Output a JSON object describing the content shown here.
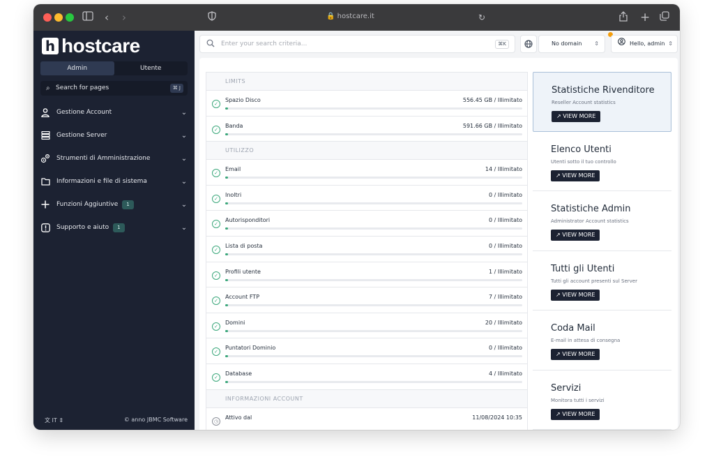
{
  "browser": {
    "address": "🔒 hostcare.it"
  },
  "sidebar": {
    "logo_letter": "h",
    "logo_text": "hostcare",
    "tabs": [
      "Admin",
      "Utente"
    ],
    "search_label": "Search for pages",
    "search_shortcut": "⌘ J",
    "items": [
      {
        "label": "Gestione Account",
        "icon": "user-icon"
      },
      {
        "label": "Gestione Server",
        "icon": "server-icon"
      },
      {
        "label": "Strumenti di Amministrazione",
        "icon": "gears-icon"
      },
      {
        "label": "Informazioni e file di sistema",
        "icon": "folder-icon"
      },
      {
        "label": "Funzioni Aggiuntive",
        "icon": "plus-icon",
        "badge": "1"
      },
      {
        "label": "Supporto e aiuto",
        "icon": "alert-icon",
        "badge": "1"
      }
    ],
    "language": "IT",
    "copyright": "© anno JBMC Software"
  },
  "topbar": {
    "search_placeholder": "Enter your search criteria...",
    "search_shortcut": "⌘K",
    "domain": "No domain",
    "user": "Hello, admin"
  },
  "stats": {
    "limits_header": "LIMITS",
    "limits": [
      {
        "label": "Spazio Disco",
        "value": "556.45 GB / Illimitato",
        "fill": 0.01
      },
      {
        "label": "Banda",
        "value": "591.66 GB / Illimitato",
        "fill": 0.01
      }
    ],
    "usage_header": "UTILIZZO",
    "usage": [
      {
        "label": "Email",
        "value": "14 / Illimitato",
        "fill": 0.01
      },
      {
        "label": "Inoltri",
        "value": "0 / Illimitato",
        "fill": 0.01
      },
      {
        "label": "Autorisponditori",
        "value": "0 / Illimitato",
        "fill": 0.01
      },
      {
        "label": "Lista di posta",
        "value": "0 / Illimitato",
        "fill": 0.01
      },
      {
        "label": "Profili utente",
        "value": "1 / Illimitato",
        "fill": 0.01
      },
      {
        "label": "Account FTP",
        "value": "7 / Illimitato",
        "fill": 0.01
      },
      {
        "label": "Domini",
        "value": "20 / Illimitato",
        "fill": 0.01
      },
      {
        "label": "Puntatori Dominio",
        "value": "0 / Illimitato",
        "fill": 0.01
      },
      {
        "label": "Database",
        "value": "4 / Illimitato",
        "fill": 0.01
      }
    ],
    "info_header": "INFORMAZIONI ACCOUNT",
    "info": [
      {
        "label": "Attivo dal",
        "value": "11/08/2024 10:35"
      }
    ]
  },
  "cards": [
    {
      "title": "Statistiche Rivenditore",
      "subtitle": "Reseller Account statistics",
      "button": "VIEW MORE",
      "active": true
    },
    {
      "title": "Elenco Utenti",
      "subtitle": "Utenti sotto il tuo controllo",
      "button": "VIEW MORE"
    },
    {
      "title": "Statistiche Admin",
      "subtitle": "Administrator Account statistics",
      "button": "VIEW MORE"
    },
    {
      "title": "Tutti gli Utenti",
      "subtitle": "Tutti gli account presenti sul Server",
      "button": "VIEW MORE"
    },
    {
      "title": "Coda Mail",
      "subtitle": "E-mail in attesa di consegna",
      "button": "VIEW MORE"
    },
    {
      "title": "Servizi",
      "subtitle": "Monitora tutti i servizi",
      "button": "VIEW MORE"
    }
  ],
  "colors": {
    "sidebar_bg": "#1c2232",
    "accent_green": "#3aa77a",
    "badge_bg": "#2d5a5a",
    "notif": "#f59e0b"
  }
}
